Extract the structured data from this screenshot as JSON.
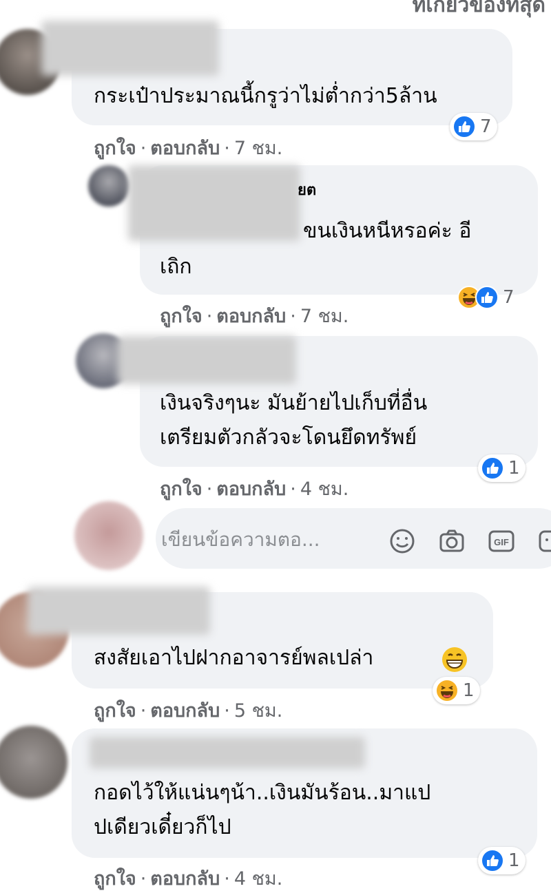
{
  "header": {
    "partial_title": "ที่เกี่ยวข้องที่สุด"
  },
  "comments": [
    {
      "text_lines": [
        "กระเป๋าประมาณนี้กรูว่าไม่ต่ำกว่า5ล้าน"
      ],
      "like_label": "ถูกใจ",
      "reply_label": "ตอบกลับ",
      "time": "7 ชม.",
      "reaction_icons": [
        "like-icon"
      ],
      "reaction_count": "7"
    },
    {
      "name_fragment": "ยต",
      "text_lines": [
        "ขนเงินหนีหรอค่ะ อี",
        "เถิก"
      ],
      "like_label": "ถูกใจ",
      "reply_label": "ตอบกลับ",
      "time": "7 ชม.",
      "reaction_icons": [
        "haha-icon",
        "like-icon"
      ],
      "reaction_count": "7"
    },
    {
      "text_lines": [
        "เงินจริงๆนะ มันย้ายไปเก็บที่อื่น",
        "เตรียมตัวกลัวจะโดนยึดทรัพย์"
      ],
      "like_label": "ถูกใจ",
      "reply_label": "ตอบกลับ",
      "time": "4 ชม.",
      "reaction_icons": [
        "like-icon"
      ],
      "reaction_count": "1"
    },
    {
      "text_lines": [
        "สงสัยเอาไปฝากอาจารย์พลเปล่า"
      ],
      "trailing_emoji": "grinning-emoji",
      "like_label": "ถูกใจ",
      "reply_label": "ตอบกลับ",
      "time": "5 ชม.",
      "reaction_icons": [
        "haha-icon"
      ],
      "reaction_count": "1"
    },
    {
      "text_lines": [
        "กอดไว้ให้แน่นๆน้า..เงินมันร้อน..มาแป",
        "ปเดียวเดี๋ยวก็ไป"
      ],
      "like_label": "ถูกใจ",
      "reply_label": "ตอบกลับ",
      "time": "4 ชม.",
      "reaction_icons": [
        "like-icon"
      ],
      "reaction_count": "1"
    }
  ],
  "composer": {
    "placeholder": "เขียนข้อความตอ...",
    "tools": [
      "emoji-icon",
      "camera-icon",
      "gif-icon",
      "sticker-icon"
    ]
  },
  "colors": {
    "bubble": "#f0f2f5",
    "muted_text": "#65676b",
    "like_blue": "#1877f2",
    "haha_yellow": "#f7b125"
  }
}
